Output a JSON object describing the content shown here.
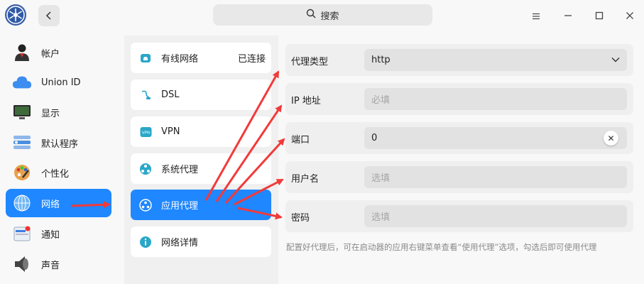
{
  "titlebar": {
    "search_placeholder": "搜索",
    "back_icon": "chevron-left-icon",
    "menu_icon": "menu-icon",
    "minimize_icon": "minimize-icon",
    "maximize_icon": "maximize-icon",
    "close_icon": "close-icon"
  },
  "sidebar": {
    "items": [
      {
        "label": "帐户",
        "icon": "account-icon"
      },
      {
        "label": "Union ID",
        "icon": "cloud-icon"
      },
      {
        "label": "显示",
        "icon": "monitor-icon"
      },
      {
        "label": "默认程序",
        "icon": "default-apps-icon"
      },
      {
        "label": "个性化",
        "icon": "palette-icon"
      },
      {
        "label": "网络",
        "icon": "network-icon",
        "active": true
      },
      {
        "label": "通知",
        "icon": "notification-icon"
      },
      {
        "label": "声音",
        "icon": "speaker-icon"
      }
    ]
  },
  "network_menu": {
    "items": [
      {
        "label": "有线网络",
        "status": "已连接",
        "icon": "wired-icon"
      },
      {
        "label": "DSL",
        "icon": "dsl-icon"
      },
      {
        "label": "VPN",
        "icon": "vpn-icon"
      },
      {
        "label": "系统代理",
        "icon": "system-proxy-icon"
      },
      {
        "label": "应用代理",
        "icon": "app-proxy-icon",
        "active": true
      },
      {
        "label": "网络详情",
        "icon": "info-icon"
      }
    ]
  },
  "proxy_form": {
    "type_label": "代理类型",
    "type_value": "http",
    "ip_label": "IP 地址",
    "ip_placeholder": "必填",
    "port_label": "端口",
    "port_value": "0",
    "user_label": "用户名",
    "user_placeholder": "选填",
    "password_label": "密码",
    "password_placeholder": "选填",
    "hint": "配置好代理后，可在启动器的应用右键菜单查看“使用代理”选项，勾选后即可使用代理"
  },
  "colors": {
    "accent": "#1f87ff",
    "annotation_arrow": "#f23a3a"
  }
}
